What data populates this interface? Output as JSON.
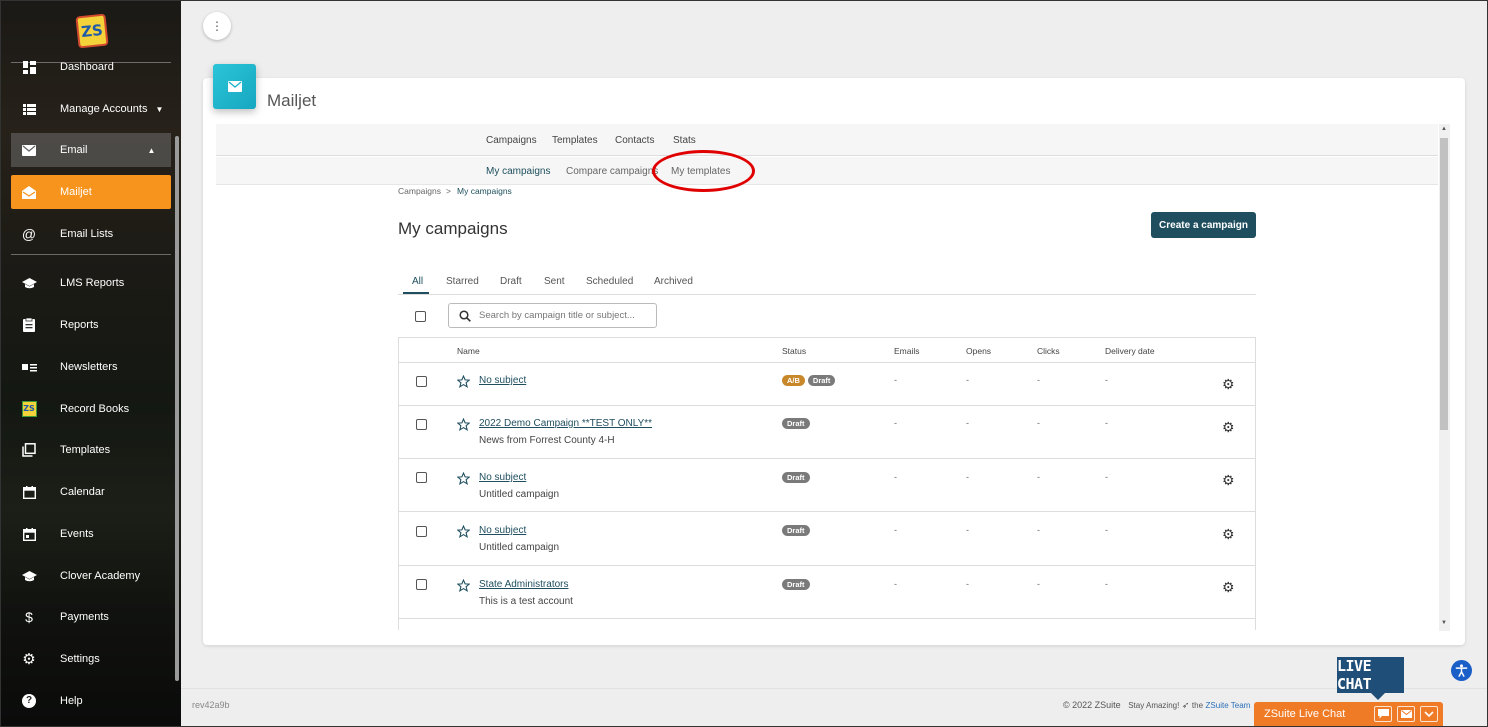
{
  "sidebar": {
    "logo_text": "ZS",
    "items": [
      {
        "label": "Dashboard",
        "icon": "dashboard-icon"
      },
      {
        "label": "Manage Accounts",
        "icon": "list-icon"
      },
      {
        "label": "Email",
        "icon": "envelope-icon"
      },
      {
        "label": "Mailjet",
        "icon": "open-envelope-icon"
      },
      {
        "label": "Email Lists",
        "icon": "at-icon"
      },
      {
        "label": "LMS Reports",
        "icon": "graduation-cap-icon"
      },
      {
        "label": "Reports",
        "icon": "clipboard-icon"
      },
      {
        "label": "Newsletters",
        "icon": "newsletter-icon"
      },
      {
        "label": "Record Books",
        "icon": "zs-logo-icon"
      },
      {
        "label": "Templates",
        "icon": "copy-icon"
      },
      {
        "label": "Calendar",
        "icon": "calendar-icon"
      },
      {
        "label": "Events",
        "icon": "calendar-event-icon"
      },
      {
        "label": "Clover Academy",
        "icon": "graduation-cap-icon"
      },
      {
        "label": "Payments",
        "icon": "dollar-icon"
      },
      {
        "label": "Settings",
        "icon": "gear-icon"
      },
      {
        "label": "Help",
        "icon": "help-icon"
      }
    ]
  },
  "card": {
    "title": "Mailjet"
  },
  "mailjet": {
    "top_nav": [
      "Campaigns",
      "Templates",
      "Contacts",
      "Stats"
    ],
    "sub_nav": [
      "My campaigns",
      "Compare campaigns",
      "My templates"
    ],
    "breadcrumb": [
      "Campaigns",
      ">",
      "My campaigns"
    ],
    "heading": "My campaigns",
    "create_button": "Create a campaign",
    "tabs": [
      "All",
      "Starred",
      "Draft",
      "Sent",
      "Scheduled",
      "Archived"
    ],
    "search_placeholder": "Search by campaign title or subject...",
    "columns": [
      "Name",
      "Status",
      "Emails",
      "Opens",
      "Clicks",
      "Delivery date"
    ],
    "rows": [
      {
        "title": "No subject",
        "subtitle": "",
        "badges": [
          "A/B",
          "Draft"
        ],
        "emails": "-",
        "opens": "-",
        "clicks": "-",
        "delivery": "-"
      },
      {
        "title": "2022 Demo Campaign **TEST ONLY**",
        "subtitle": "News from Forrest County 4-H",
        "badges": [
          "Draft"
        ],
        "emails": "-",
        "opens": "-",
        "clicks": "-",
        "delivery": "-"
      },
      {
        "title": "No subject",
        "subtitle": "Untitled campaign",
        "badges": [
          "Draft"
        ],
        "emails": "-",
        "opens": "-",
        "clicks": "-",
        "delivery": "-"
      },
      {
        "title": "No subject",
        "subtitle": "Untitled campaign",
        "badges": [
          "Draft"
        ],
        "emails": "-",
        "opens": "-",
        "clicks": "-",
        "delivery": "-"
      },
      {
        "title": "State Administrators",
        "subtitle": "This is a test account",
        "badges": [
          "Draft"
        ],
        "emails": "-",
        "opens": "-",
        "clicks": "-",
        "delivery": "-"
      }
    ]
  },
  "footer": {
    "rev": "rev42a9b",
    "copyright": "© 2022 ZSuite",
    "tagline": "Stay Amazing!",
    "the": "the",
    "team": "ZSuite Team"
  },
  "livechat": {
    "bubble": "LIVE CHAT",
    "bar_label": "ZSuite Live Chat"
  },
  "colors": {
    "accent_orange": "#f7941e",
    "primary_dark_teal": "#1f4e5f",
    "mailjet_icon": "#1ab3ca",
    "annotation_red": "#e00000",
    "livechat_orange": "#f07b26"
  }
}
